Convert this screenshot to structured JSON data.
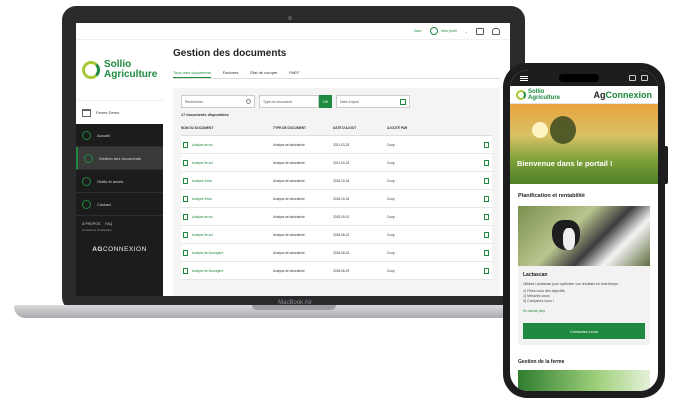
{
  "laptop": {
    "model": "MacBook Air",
    "topbar": {
      "left_link": "Inscr.",
      "right_link": "Mon profil"
    },
    "sidebar": {
      "logo_line1": "Sollio",
      "logo_line2": "Agriculture",
      "farm": "Ferme Démo",
      "items": [
        {
          "label": "Accueil"
        },
        {
          "label": "Gestion des documents"
        },
        {
          "label": "Outils et accès"
        },
        {
          "label": "Contact"
        }
      ],
      "small_links": [
        "À PROPOS",
        "FAQ"
      ],
      "conditions": "Conditions d'utilisation",
      "brand_bold": "AG",
      "brand_rest": "CONNEXION"
    },
    "main": {
      "title": "Gestion des documents",
      "tabs": [
        "Tous mes documents",
        "Factures",
        "État de compte",
        "PAEF"
      ],
      "filters": {
        "search_placeholder": "Rechercher",
        "type_placeholder": "Type de document",
        "type_button": "OK",
        "date_placeholder": "Date d'ajout"
      },
      "count": "17 documents disponibles",
      "columns": [
        "NOM DU DOCUMENT",
        "TYPE DE DOCUMENT",
        "DATE D'AJOUT",
        "AJOUTÉ PAR"
      ],
      "rows": [
        {
          "name": "Analyse de sol",
          "type": "Analyse de laboratoire",
          "date": "2021-03-23",
          "by": "Coop"
        },
        {
          "name": "Analyse de sol",
          "type": "Analyse de laboratoire",
          "date": "2021-03-23",
          "by": "Coop"
        },
        {
          "name": "Analyse d'eau",
          "type": "Analyse de laboratoire",
          "date": "2018-10-04",
          "by": "Coop"
        },
        {
          "name": "Analyse d'eau",
          "type": "Analyse de laboratoire",
          "date": "2018-10-04",
          "by": "Coop"
        },
        {
          "name": "Analyse de sol",
          "type": "Analyse de laboratoire",
          "date": "2018-09-10",
          "by": "Coop"
        },
        {
          "name": "Analyse de sol",
          "type": "Analyse de laboratoire",
          "date": "2018-08-22",
          "by": "Coop"
        },
        {
          "name": "Analyse de fourragère",
          "type": "Analyse de laboratoire",
          "date": "2018-08-02",
          "by": "Coop"
        },
        {
          "name": "Analyse de fourragère",
          "type": "Analyse de laboratoire",
          "date": "2018-06-29",
          "by": "Coop"
        }
      ]
    }
  },
  "phone": {
    "logo_line1": "Sollio",
    "logo_line2": "Agriculture",
    "brand_a": "Ag",
    "brand_b": "Connexion",
    "hero_title": "Bienvenue dans le portail !",
    "section1": "Planification et rentabilité",
    "card": {
      "title": "Lactascan",
      "desc": "Utilisez Lactascan pour optimiser vos résultats en trois temps :",
      "steps": [
        "1) Fixez-vous des objectifs;",
        "2) Mesurez-vous;",
        "3) Comparez-vous !"
      ],
      "link": "En savoir plus",
      "cta": "Contactez-nous"
    },
    "section2": "Gestion de la ferme"
  }
}
